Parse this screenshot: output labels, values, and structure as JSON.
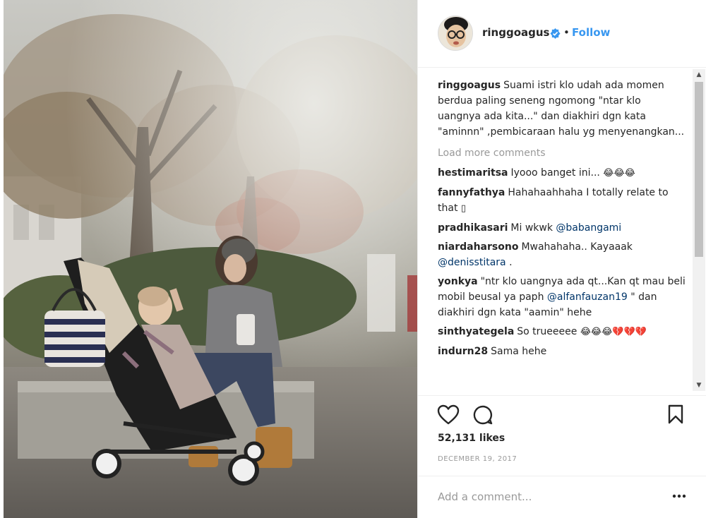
{
  "post": {
    "username": "ringgoagus",
    "verified": true,
    "follow_label": "Follow",
    "separator": "•",
    "caption": {
      "username": "ringgoagus",
      "text": "Suami istri klo udah ada momen berdua paling seneng ngomong \"ntar klo uangnya ada kita...\" dan diakhiri dgn kata \"aminnn\" ,pembicaraan halu yg menyenangkan..."
    },
    "load_more_label": "Load more comments",
    "comments": [
      {
        "username": "hestimaritsa",
        "text": "Iyooo banget ini... ",
        "emoji": "😂😂😂"
      },
      {
        "username": "fannyfathya",
        "text": "Hahahaahhaha I totally relate to that ",
        "emoji": "▯"
      },
      {
        "username": "pradhikasari",
        "text": "Mi wkwk ",
        "mention": "@babangami"
      },
      {
        "username": "niardaharsono",
        "text": "Mwahahaha.. Kayaaak ",
        "mention": "@denisstitara",
        "suffix": " ."
      },
      {
        "username": "yonkya",
        "text": "\"ntr klo uangnya ada qt...Kan qt mau beli mobil beusal ya paph ",
        "mention": "@alfanfauzan19",
        "suffix": " \" dan diakhiri dgn kata \"aamin\" hehe"
      },
      {
        "username": "sinthyategela",
        "text": "So trueeeee ",
        "emoji": "😂😂😂💔💔💔"
      },
      {
        "username": "indurn28",
        "text": "Sama hehe"
      }
    ],
    "likes": "52,131 likes",
    "date": "DECEMBER 19, 2017",
    "add_comment_placeholder": "Add a comment...",
    "more_label": "•••"
  },
  "icons": {
    "verified": "verified-badge-icon",
    "heart": "heart-icon",
    "comment": "comment-icon",
    "bookmark": "bookmark-icon",
    "more": "more-options-icon"
  },
  "colors": {
    "follow": "#3897f0",
    "verified": "#3897f0",
    "mention": "#003569",
    "muted": "#999999"
  }
}
